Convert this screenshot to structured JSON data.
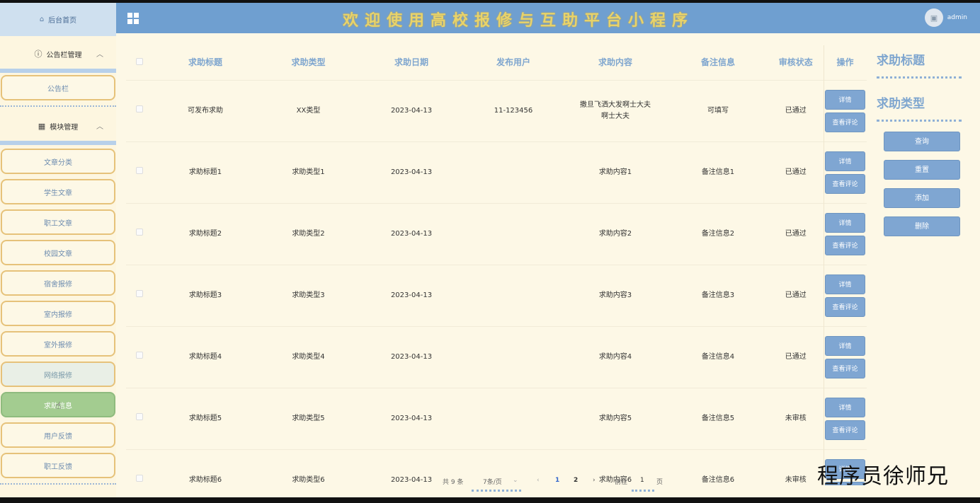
{
  "header": {
    "title": "欢迎使用高校报修与互助平台小程序",
    "user": "admin"
  },
  "sidebar": {
    "home": "后台首页",
    "group1": {
      "label": "公告栏管理",
      "items": [
        "公告栏"
      ]
    },
    "group2": {
      "label": "模块管理",
      "items": [
        "文章分类",
        "学生文章",
        "职工文章",
        "校园文章",
        "宿舍报修",
        "室内报修",
        "室外报修",
        "网络报修",
        "求助信息",
        "用户反馈",
        "职工反馈"
      ]
    }
  },
  "table": {
    "headers": [
      "求助标题",
      "求助类型",
      "求助日期",
      "发布用户",
      "求助内容",
      "备注信息",
      "审核状态",
      "操作"
    ],
    "rows": [
      [
        "可发布求助",
        "XX类型",
        "2023-04-13",
        "11-123456",
        "撒旦飞洒大发啊士大夫啊士大夫",
        "可填写",
        "已通过"
      ],
      [
        "求助标题1",
        "求助类型1",
        "2023-04-13",
        "",
        "求助内容1",
        "备注信息1",
        "已通过"
      ],
      [
        "求助标题2",
        "求助类型2",
        "2023-04-13",
        "",
        "求助内容2",
        "备注信息2",
        "已通过"
      ],
      [
        "求助标题3",
        "求助类型3",
        "2023-04-13",
        "",
        "求助内容3",
        "备注信息3",
        "已通过"
      ],
      [
        "求助标题4",
        "求助类型4",
        "2023-04-13",
        "",
        "求助内容4",
        "备注信息4",
        "已通过"
      ],
      [
        "求助标题5",
        "求助类型5",
        "2023-04-13",
        "",
        "求助内容5",
        "备注信息5",
        "未审核"
      ],
      [
        "求助标题6",
        "求助类型6",
        "2023-04-13",
        "",
        "求助内容6",
        "备注信息6",
        "未审核"
      ]
    ],
    "btn_detail": "详情",
    "btn_comment": "查看评论"
  },
  "search": {
    "label1": "求助标题",
    "label2": "求助类型",
    "btn_query": "查询",
    "btn_reset": "重置",
    "btn_add": "添加",
    "btn_delete": "删除"
  },
  "pager": {
    "total": "共 9 条",
    "per_page": "7条/页",
    "page1": "1",
    "page2": "2",
    "goto_label": "前往",
    "goto_value": "1",
    "page_unit": "页"
  },
  "watermark": "程序员徐师兄",
  "colors": {
    "header": "#6f9fd0",
    "button": "#7fa6d2",
    "active": "#a3cc90",
    "title": "#e8d36a"
  }
}
